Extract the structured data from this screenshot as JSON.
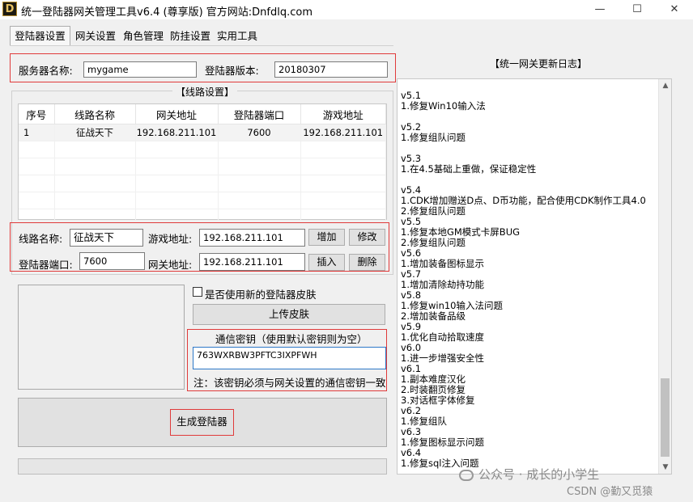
{
  "window": {
    "title": "统一登陆器网关管理工具v6.4 (尊享版)   官方网站:Dnfdlq.com",
    "logo_letter": "D",
    "minimize": "—",
    "maximize": "☐",
    "close": "✕"
  },
  "tabs": [
    "登陆器设置",
    "网关设置",
    "角色管理",
    "防挂设置",
    "实用工具"
  ],
  "server": {
    "name_label": "服务器名称:",
    "name_value": "mygame",
    "version_label": "登陆器版本:",
    "version_value": "20180307"
  },
  "lines": {
    "group_title": "【线路设置】",
    "columns": [
      "序号",
      "线路名称",
      "网关地址",
      "登陆器端口",
      "游戏地址"
    ],
    "rows": [
      [
        "1",
        "征战天下",
        "192.168.211.101",
        "7600",
        "192.168.211.101"
      ]
    ]
  },
  "line_form": {
    "name_label": "线路名称:",
    "name_value": "征战天下",
    "game_addr_label": "游戏地址:",
    "game_addr_value": "192.168.211.101",
    "port_label": "登陆器端口:",
    "port_value": "7600",
    "gateway_label": "网关地址:",
    "gateway_value": "192.168.211.101",
    "add_btn": "增加",
    "modify_btn": "修改",
    "insert_btn": "插入",
    "delete_btn": "删除"
  },
  "skin": {
    "checkbox_label": "是否使用新的登陆器皮肤",
    "upload_btn": "上传皮肤"
  },
  "key": {
    "title": "通信密钥（使用默认密钥则为空）",
    "value": "763WXRBW3PFTC3IXPFWH",
    "note": "注：该密钥必须与网关设置的通信密钥一致"
  },
  "generate_btn": "生成登陆器",
  "log": {
    "title": "【统一网关更新日志】",
    "lines": [
      "",
      "v5.1",
      "1.修复Win10输入法",
      "",
      "v5.2",
      "1.修复组队问题",
      "",
      "v5.3",
      "1.在4.5基础上重做，保证稳定性",
      "",
      "v5.4",
      "1.CDK增加赠送D点、D币功能，配合使用CDK制作工具4.0",
      "2.修复组队问题",
      "v5.5",
      "1.修复本地GM模式卡屏BUG",
      "2.修复组队问题",
      "v5.6",
      "1.增加装备图标显示",
      "v5.7",
      "1.增加清除劫持功能",
      "v5.8",
      "1.修复win10输入法问题",
      "2.增加装备品级",
      "v5.9",
      "1.优化自动拾取速度",
      "v6.0",
      "1.进一步增强安全性",
      "v6.1",
      "1.副本难度汉化",
      "2.时装翻页修复",
      "3.对话框字体修复",
      "v6.2",
      "1.修复组队",
      "v6.3",
      "1.修复图标显示问题",
      "v6.4",
      "1.修复sql注入问题"
    ]
  },
  "watermarks": {
    "wechat": "公众号 · 成长的小学生",
    "csdn": "CSDN @勤又觅猿"
  }
}
